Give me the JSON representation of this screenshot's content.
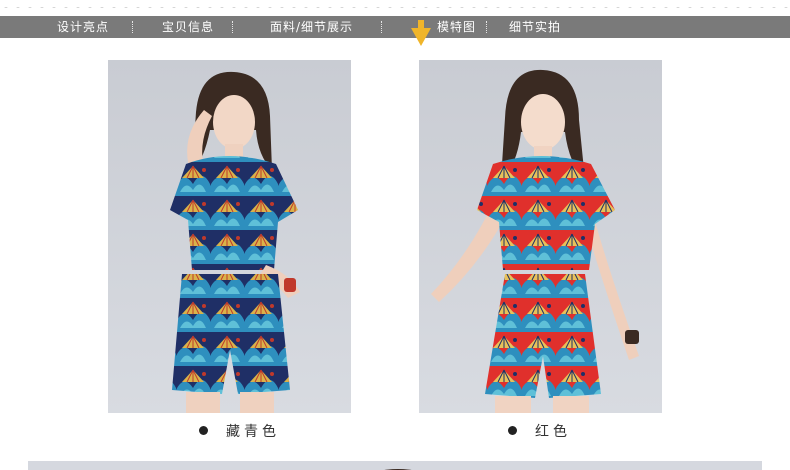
{
  "nav": {
    "items": [
      {
        "label": "设计亮点"
      },
      {
        "label": "宝贝信息"
      },
      {
        "label": "面料/细节展示"
      },
      {
        "label": "模特图"
      },
      {
        "label": "细节实拍"
      }
    ],
    "active_index": 3
  },
  "products": [
    {
      "color_label": "藏青色"
    },
    {
      "color_label": "红色"
    }
  ],
  "colors": {
    "nav_bg": "#7a7a7a",
    "nav_text": "#ffffff",
    "pointer": "#f0b52a",
    "navy_print": "#1f2f66",
    "red_print": "#e0302c",
    "teal_print": "#2e8fbe"
  }
}
